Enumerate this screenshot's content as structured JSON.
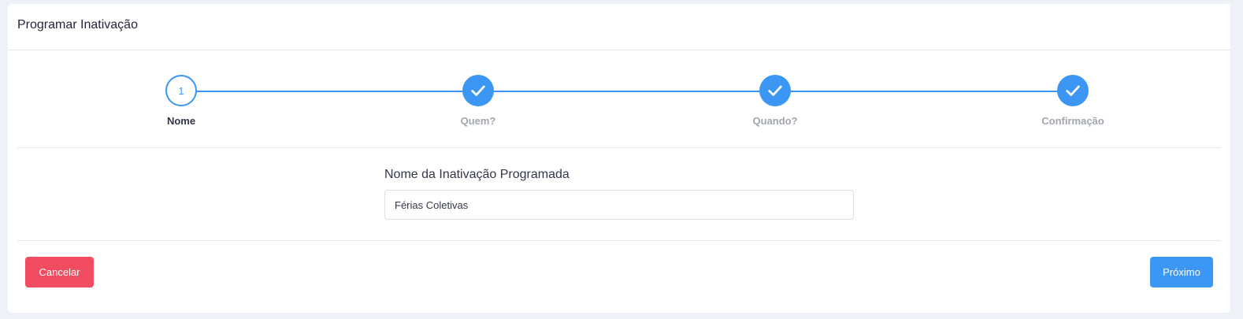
{
  "header": {
    "title": "Programar Inativação"
  },
  "stepper": {
    "accent_color": "#3b97f3",
    "steps": [
      {
        "number": "1",
        "label": "Nome",
        "state": "active",
        "icon": "step-number"
      },
      {
        "number": "",
        "label": "Quem?",
        "state": "done",
        "icon": "check-icon"
      },
      {
        "number": "",
        "label": "Quando?",
        "state": "done",
        "icon": "check-icon"
      },
      {
        "number": "",
        "label": "Confirmação",
        "state": "done",
        "icon": "check-icon"
      }
    ]
  },
  "form": {
    "name_label": "Nome da Inativação Programada",
    "name_value": "Férias Coletivas"
  },
  "footer": {
    "cancel_label": "Cancelar",
    "cancel_color": "#f24c61",
    "next_label": "Próximo",
    "next_color": "#3b97f3"
  }
}
